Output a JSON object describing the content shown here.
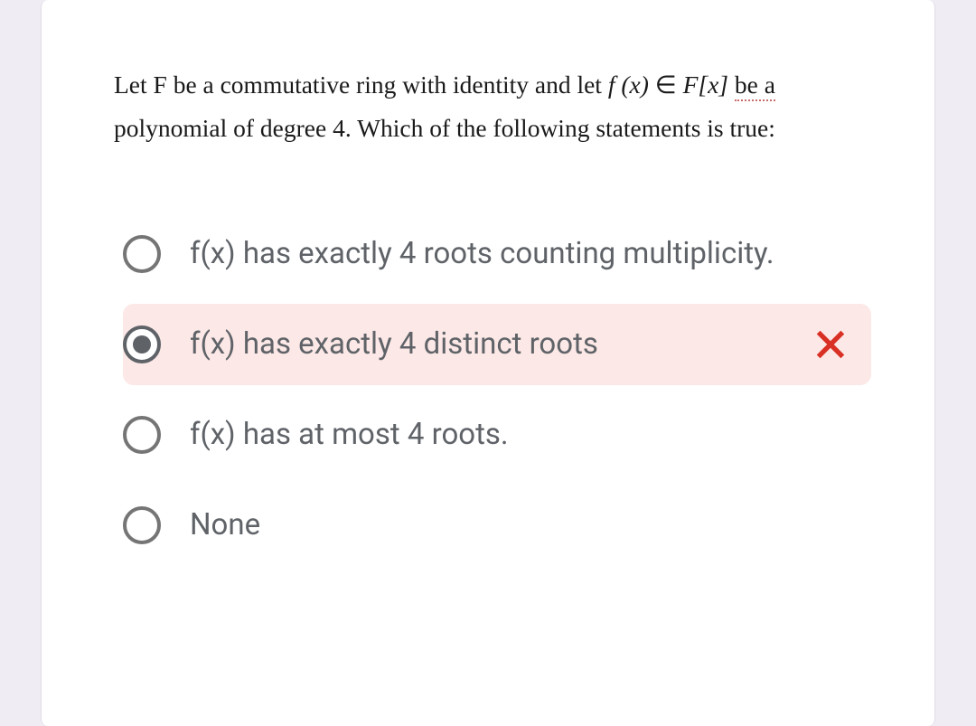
{
  "question": {
    "line1_pre": "Let F be a commutative ring with identity and let ",
    "fx": "f (x)",
    "elem": " ∈ ",
    "set": "F[x]",
    "space": " ",
    "be_a": "be  a",
    "line2": "polynomial of degree 4. Which of the following statements is true:"
  },
  "options": [
    {
      "label": "f(x) has exactly 4 roots counting multiplicity.",
      "selected": false,
      "incorrect": false
    },
    {
      "label": "f(x) has exactly 4 distinct roots",
      "selected": true,
      "incorrect": true
    },
    {
      "label": "f(x) has at most 4 roots.",
      "selected": false,
      "incorrect": false
    },
    {
      "label": "None",
      "selected": false,
      "incorrect": false
    }
  ]
}
